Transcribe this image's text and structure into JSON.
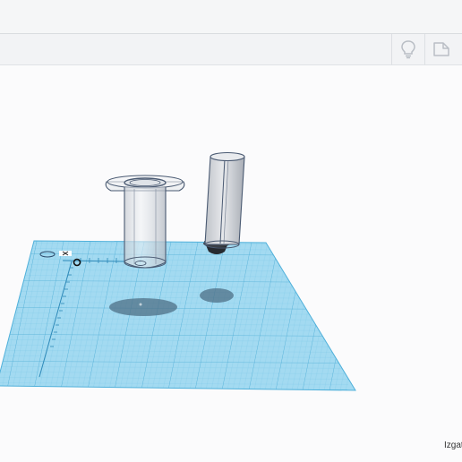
{
  "app": {
    "toolbar": {
      "buttons": [
        {
          "name": "lightbulb-icon",
          "label": "Tips"
        },
        {
          "name": "speech-bubble-icon",
          "label": "Notes"
        }
      ]
    },
    "viewport": {
      "workplane_color": "#8fd3ec",
      "grid_line_color": "#5bb7dc",
      "object_color": "#c9ccd1",
      "outline_color": "#4a5a72",
      "shadow_color": "#4d6f86"
    },
    "bottom_right_label": "Izgat"
  }
}
